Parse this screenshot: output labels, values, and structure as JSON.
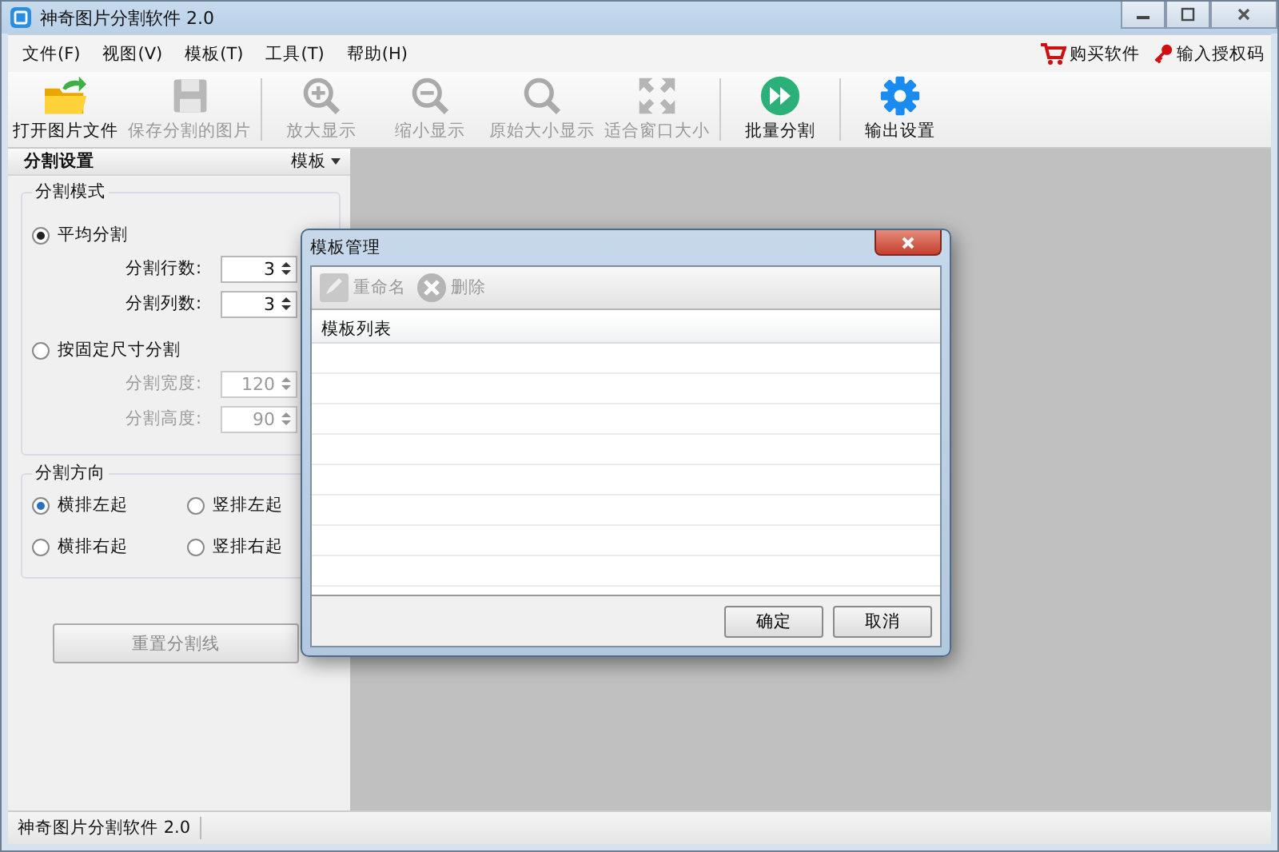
{
  "window": {
    "title": "神奇图片分割软件 2.0"
  },
  "menu": [
    {
      "label": "文件(F)"
    },
    {
      "label": "视图(V)"
    },
    {
      "label": "模板(T)"
    },
    {
      "label": "工具(T)"
    },
    {
      "label": "帮助(H)"
    }
  ],
  "menu_links": [
    {
      "label": "购买软件",
      "kind": "cart"
    },
    {
      "label": "输入授权码",
      "kind": "key"
    }
  ],
  "toolbar": {
    "groups": [
      [
        {
          "label": "打开图片文件",
          "kind": "open",
          "disabled": false
        },
        {
          "label": "保存分割的图片",
          "kind": "save",
          "disabled": true
        }
      ],
      [
        {
          "label": "放大显示",
          "kind": "zoom_in",
          "disabled": true
        },
        {
          "label": "缩小显示",
          "kind": "zoom_out",
          "disabled": true
        },
        {
          "label": "原始大小显示",
          "kind": "actual",
          "disabled": true
        },
        {
          "label": "适合窗口大小",
          "kind": "fit",
          "disabled": true
        }
      ],
      [
        {
          "label": "批量分割",
          "kind": "batch",
          "disabled": false
        }
      ],
      [
        {
          "label": "输出设置",
          "kind": "settings",
          "disabled": false
        }
      ]
    ]
  },
  "panel": {
    "title": "分割设置",
    "menu_label": "模板",
    "mode_group": {
      "title": "分割模式",
      "options": [
        {
          "label": "平均分割",
          "selected": true,
          "fields": [
            {
              "label": "分割行数:",
              "value": "3"
            },
            {
              "label": "分割列数:",
              "value": "3"
            }
          ]
        },
        {
          "label": "按固定尺寸分割",
          "selected": false,
          "fields": [
            {
              "label": "分割宽度:",
              "value": "120"
            },
            {
              "label": "分割高度:",
              "value": "90"
            }
          ]
        }
      ]
    },
    "direction_group": {
      "title": "分割方向",
      "options": [
        {
          "label": "横排左起",
          "selected": true
        },
        {
          "label": "竖排左起",
          "selected": false
        },
        {
          "label": "横排右起",
          "selected": false
        },
        {
          "label": "竖排右起",
          "selected": false
        }
      ]
    },
    "reset_button": "重置分割线"
  },
  "status_bar": "神奇图片分割软件 2.0",
  "dialog": {
    "title": "模板管理",
    "toolbar": [
      {
        "label": "重命名",
        "kind": "rename",
        "disabled": true
      },
      {
        "label": "删除",
        "kind": "delete",
        "disabled": true
      }
    ],
    "list_header": "模板列表",
    "buttons": [
      "确定",
      "取消"
    ]
  }
}
